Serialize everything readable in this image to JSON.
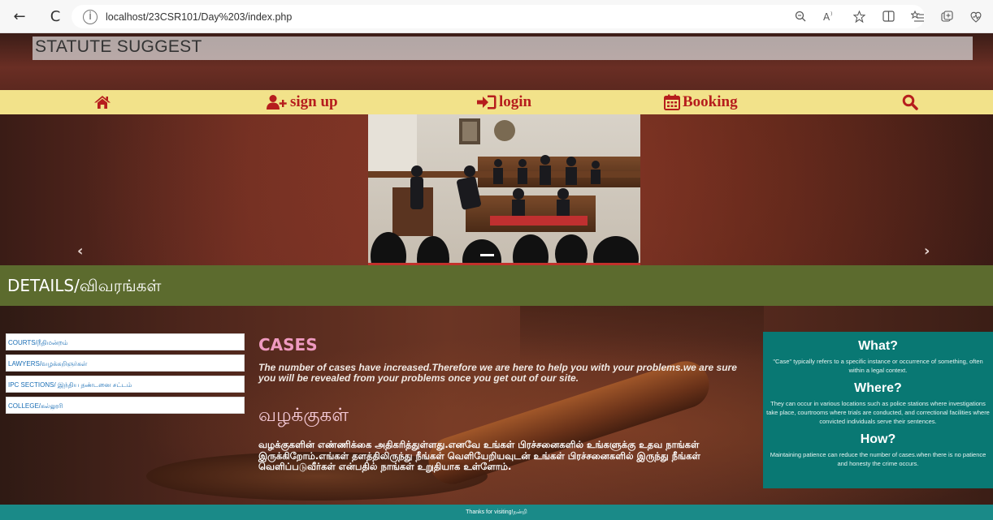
{
  "browser": {
    "url": "localhost/23CSR101/Day%203/index.php",
    "back_icon": "←",
    "refresh_icon": "C",
    "info_icon": "i"
  },
  "site": {
    "title": "STATUTE SUGGEST"
  },
  "nav": {
    "home_icon": "home-icon",
    "signup_label": "sign up",
    "login_label": "login",
    "booking_label": "Booking",
    "search_icon": "search-icon",
    "accent_color": "#b61d1d",
    "bar_color": "#f2e28a"
  },
  "carousel": {
    "prev_label": "‹",
    "next_label": "›"
  },
  "details": {
    "title": "DETAILS/விவரங்கள்"
  },
  "side_menu": {
    "items": [
      "COURTS/நீதிமன்றம்",
      "LAWYERS/வழக்கறிஞர்கள்",
      "IPC SECTIONS/ இந்திய தண்டனை சட்டம்",
      "COLLEGE/கல்லூரி"
    ]
  },
  "cases": {
    "title": "CASES",
    "text": "The number of cases have increased.Therefore we are here to help you with your problems.we are sure you will be revealed from your problems once you get out of our site.",
    "tamil_title": "வழக்குகள்",
    "tamil_text": "வழக்குகளின் எண்ணிக்கை அதிகரித்துள்ளது.எனவே உங்கள் பிரச்சனைகளில் உங்களுக்கு உதவ நாங்கள் இருக்கிறோம்.எங்கள் தளத்திலிருந்து நீங்கள் வெளியேறியவுடன் உங்கள் பிரச்சனைகளில் இருந்து நீங்கள் வெளிப்படுவீர்கள் என்பதில் நாங்கள் உறுதியாக உள்ளோம்."
  },
  "info": {
    "what_title": "What?",
    "what_text": "\"Case\" typically refers to a specific instance or occurrence of something, often within a legal context.",
    "where_title": "Where?",
    "where_text": "They can occur in various locations such as police stations where investigations take place, courtrooms where trials are conducted, and correctional facilities where convicted individuals serve their sentences.",
    "how_title": "How?",
    "how_text": "Maintaining patience can reduce the number of cases.when there is no patience and honesty the crime occurs.",
    "box_color": "#097873"
  },
  "footer": {
    "text": "Thanks for visiting!நன்றி"
  }
}
